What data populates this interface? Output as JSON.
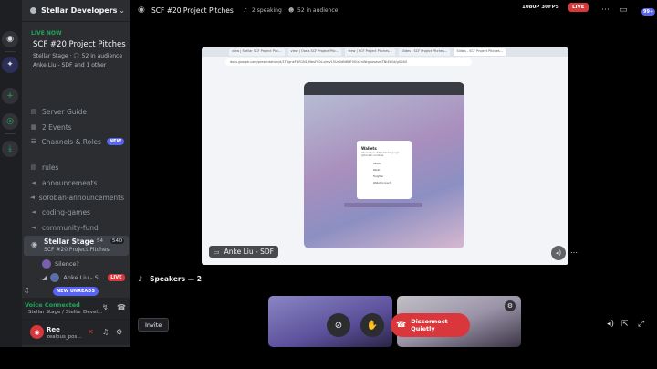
{
  "server": {
    "name": "Stellar Developers"
  },
  "live": {
    "label": "LIVE NOW",
    "title": "SCF #20 Project Pitches",
    "subtitle": "Stellar Stage · 🎧 52 in audience",
    "hosts": "Anke Liu - SDF and 1 other"
  },
  "sidebar": {
    "items": [
      {
        "icon": "guide-icon",
        "label": "Server Guide"
      },
      {
        "icon": "calendar-icon",
        "label": "2 Events"
      },
      {
        "icon": "channels-icon",
        "label": "Channels & Roles",
        "badge": "NEW"
      },
      {
        "icon": "rules-icon",
        "label": "rules"
      },
      {
        "icon": "megaphone-icon",
        "label": "announcements"
      },
      {
        "icon": "megaphone-icon",
        "label": "soroban-announcements"
      },
      {
        "icon": "megaphone-icon",
        "label": "coding-games"
      },
      {
        "icon": "megaphone-icon",
        "label": "community-fund"
      }
    ],
    "stage": {
      "name": "Stellar Stage",
      "sub": "SCF #20 Project Pitches",
      "count_a": "54",
      "count_b": "54D"
    },
    "silence": "Silence?",
    "speaker": "Anke Liu - S…",
    "speaker_badge": "LIVE",
    "new_unreads": "NEW UNREADS"
  },
  "voice": {
    "status": "Voice Connected",
    "location": "Stellar Stage / Stellar Devel…"
  },
  "user": {
    "name": "Ree",
    "status": "zealous_pos…"
  },
  "topbar": {
    "title": "SCF #20 Project Pitches",
    "speaking": "2 speaking",
    "audience": "52 in audience",
    "notif_count": "99+"
  },
  "screen": {
    "resolution": "1080P 30FPS",
    "live": "LIVE",
    "presenter": "Anke Liu - SDF",
    "browser_tabs": [
      "view | Stellar SCF Project Pitc…",
      "view | Oasis SCF Project Pitc…",
      "view | SCF Project Pitches…",
      "Slides - SCF Project Pitches…",
      "Slides - SCF Project Pitches…"
    ],
    "browser_url": "docs.google.com/presentation/d/1T5gneFNR1N1JMbsFC0Lu/mVL5Ua0dN6NF0Glx2nWrgposesmTNi4W/d/gG8X0",
    "inner_title": "Wallets",
    "inner_text": "Choose one of the following login options to continue.",
    "inner_options": [
      "Albedo",
      "Rabet",
      "Freighter",
      "Wallet Connect"
    ]
  },
  "speakers": {
    "heading": "Speakers — 2"
  },
  "controls": {
    "disconnect": "Disconnect Quietly",
    "invite": "Invite"
  }
}
